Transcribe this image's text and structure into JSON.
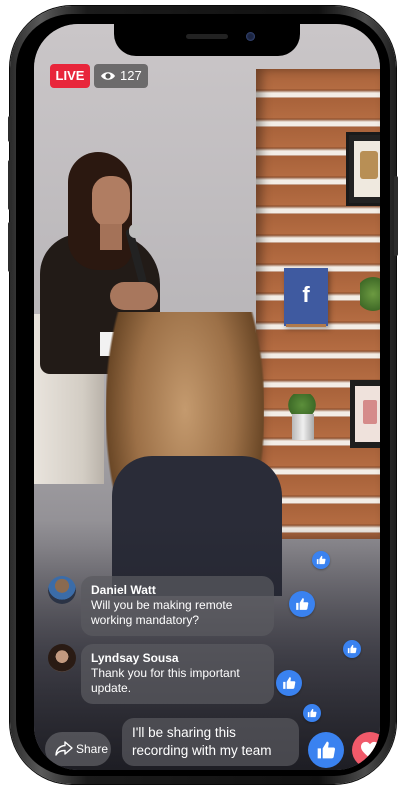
{
  "status": {
    "live_label": "LIVE",
    "viewer_count": "127"
  },
  "comments": [
    {
      "name": "Daniel Watt",
      "text_line1": "Will you be making remote",
      "text_line2": "working mandatory?"
    },
    {
      "name": "Lyndsay Sousa",
      "text_line1": "Thank you for this important",
      "text_line2": "update."
    }
  ],
  "composer": {
    "share_label": "Share",
    "message_line1": "I'll be sharing this",
    "message_line2": "recording with my team"
  },
  "scene": {
    "sign_letter": "f"
  },
  "colors": {
    "live_red": "#e8263b",
    "like_blue": "#3a82f0",
    "love_red": "#f05a6a"
  },
  "icons": [
    "eye-icon",
    "share-icon",
    "thumbs-up-icon",
    "heart-icon"
  ]
}
